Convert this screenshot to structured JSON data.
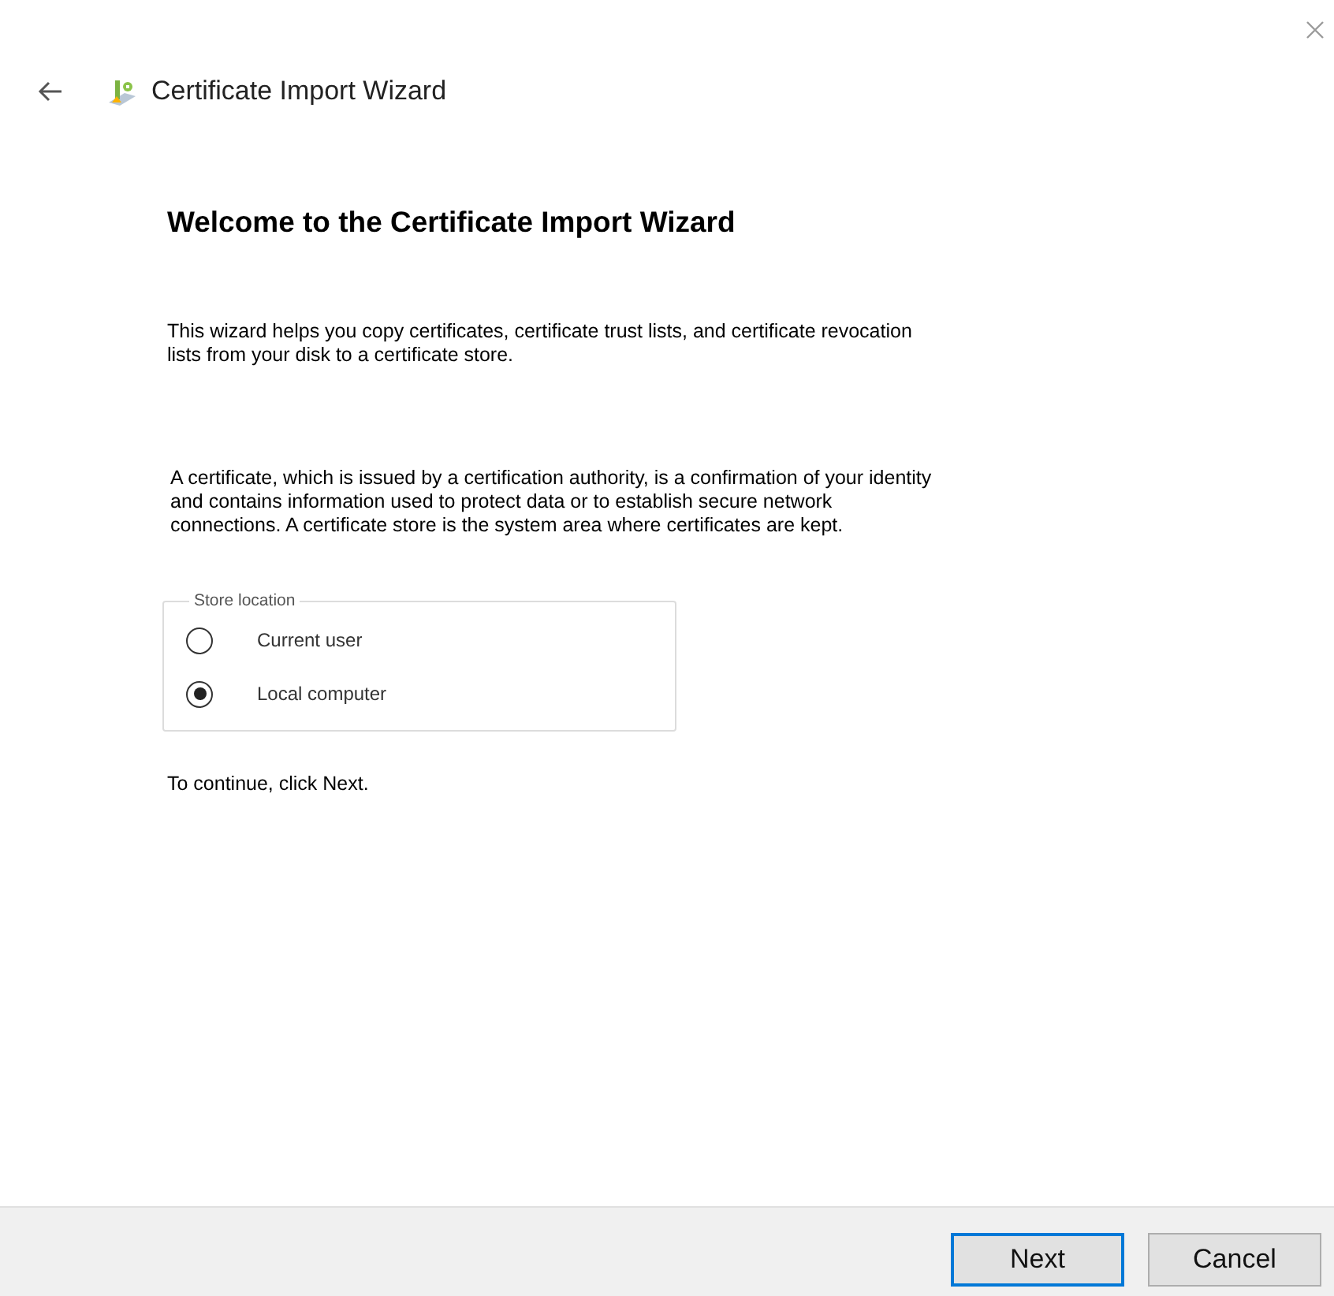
{
  "window": {
    "title": "Certificate Import Wizard"
  },
  "heading": "Welcome to the Certificate Import Wizard",
  "paragraphs": [
    {
      "lines": [
        "This wizard helps you copy certificates, certificate trust lists, and certificate revocation",
        "lists from your disk to a certificate store."
      ]
    },
    {
      "lines": [
        "A certificate, which is issued by a certification authority, is a confirmation of your identity",
        "and contains information used to protect data or to establish secure network",
        "connections. A certificate store is the system area where certificates are kept."
      ]
    }
  ],
  "store_location": {
    "legend": "Store location",
    "options": [
      {
        "label": "Current user",
        "selected": false
      },
      {
        "label": "Local computer",
        "selected": true
      }
    ]
  },
  "hint": "To continue, click Next.",
  "buttons": [
    {
      "label": "Next",
      "default": true
    },
    {
      "label": "Cancel",
      "default": false
    }
  ]
}
